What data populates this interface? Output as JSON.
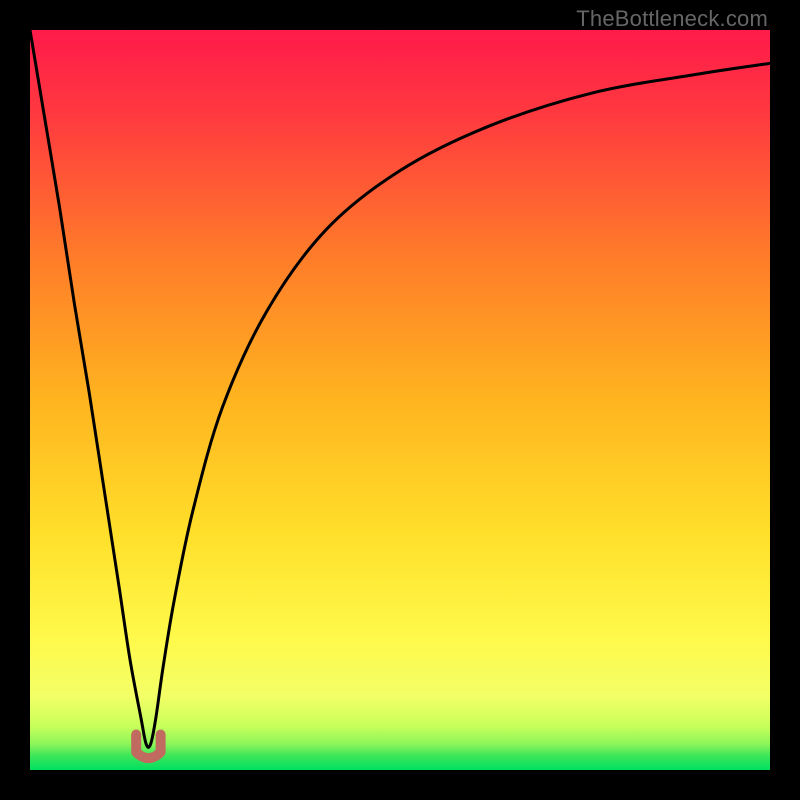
{
  "watermark": "TheBottleneck.com",
  "chart_data": {
    "type": "line",
    "title": "",
    "xlabel": "",
    "ylabel": "",
    "xlim": [
      0,
      100
    ],
    "ylim": [
      0,
      100
    ],
    "grid": false,
    "legend": false,
    "background_gradient": {
      "top_color": "#ff1a4a",
      "mid_color": "#ffd400",
      "low_color": "#faff66",
      "bottom_color": "#00e060"
    },
    "curve_comment": "V-shaped black curve dipping near x≈16, y≈3; left branch goes to top-left corner, right branch rises toward upper-right. Values estimated from pixels.",
    "series": [
      {
        "name": "curve",
        "color": "#000000",
        "x": [
          0,
          2,
          4,
          6,
          8,
          10,
          12,
          13.5,
          15,
          15.7,
          16.3,
          17,
          18,
          19.5,
          22,
          26,
          32,
          40,
          50,
          62,
          76,
          90,
          100
        ],
        "y": [
          100,
          88,
          76,
          63,
          51,
          38,
          25,
          15,
          7,
          3.5,
          3.5,
          7,
          14,
          23,
          35,
          49,
          62,
          73,
          81,
          87,
          91.5,
          94,
          95.5
        ]
      }
    ],
    "marker": {
      "comment": "Small reddish U-shaped marker at the curve minimum",
      "color": "#c06a60",
      "cx": 16,
      "cy": 3.2,
      "width": 3.3,
      "height": 3.2
    }
  }
}
